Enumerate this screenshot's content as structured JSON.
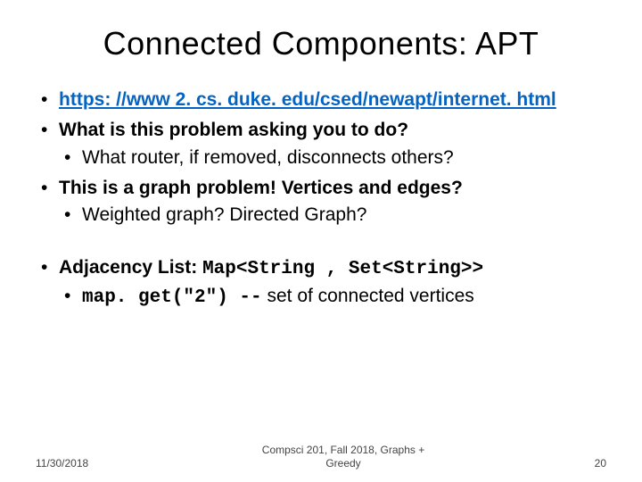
{
  "title": "Connected Components: APT",
  "bullets": {
    "link": "https: //www 2. cs. duke. edu/csed/newapt/internet. html",
    "q1": "What is this problem asking you to do?",
    "q1a": "What router, if removed, disconnects others?",
    "q2": "This is a graph problem! Vertices and edges?",
    "q2a": "Weighted graph? Directed Graph?",
    "adj_prefix": "Adjacency List: ",
    "adj_code": "Map<String , Set<String>>",
    "map_code": "map. get(\"2\") --",
    "map_rest": " set of connected vertices"
  },
  "footer": {
    "date": "11/30/2018",
    "center1": "Compsci 201, Fall 2018, Graphs +",
    "center2": "Greedy",
    "page": "20"
  }
}
